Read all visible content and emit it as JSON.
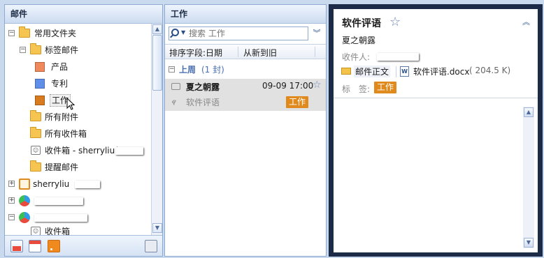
{
  "left_pane": {
    "title": "邮件",
    "tree": [
      {
        "label": "常用文件夹",
        "expander": "−"
      },
      {
        "label": "标签邮件",
        "expander": "−"
      },
      {
        "label": "产品",
        "color": "#f08a5d"
      },
      {
        "label": "专利",
        "color": "#5f8fe8"
      },
      {
        "label": "工作",
        "color": "#d87a1e"
      },
      {
        "label": "所有附件"
      },
      {
        "label": "所有收件箱"
      },
      {
        "label": "收件箱 - sherryliu("
      },
      {
        "label": "提醒邮件"
      },
      {
        "label": "sherryliu",
        "expander": "+"
      },
      {
        "expander": "+"
      },
      {
        "expander": "−"
      },
      {
        "label": "收件箱"
      }
    ]
  },
  "middle_pane": {
    "title": "工作",
    "search_placeholder": "搜索 工作",
    "sort_field": "排序字段:日期",
    "sort_order": "从新到旧",
    "group_label": "上周",
    "group_count": "(1 封)",
    "message": {
      "sender": "夏之朝露",
      "date": "09-09 17:00",
      "subject": "软件评语",
      "tag": "工作"
    }
  },
  "reading_pane": {
    "subject": "软件评语",
    "sender": "夏之朝露",
    "to_label": "收件人:",
    "body_tab": "邮件正文",
    "attachment_name": "软件评语.docx",
    "attachment_size": "( 204.5 K)",
    "tag_label": "标　签:",
    "tag": "工作"
  },
  "colors": {
    "accent": "#e08a1e",
    "pane_header": "#cddcf1",
    "selected_row": "#e1e1e1",
    "group_text": "#4a6fb0"
  },
  "icons": [
    "folder-icon",
    "tag-icon",
    "inbox-icon",
    "account-icon",
    "search-icon",
    "star-icon",
    "envelope-icon",
    "paperclip-icon",
    "word-doc-icon",
    "calendar-icon",
    "rss-icon"
  ]
}
